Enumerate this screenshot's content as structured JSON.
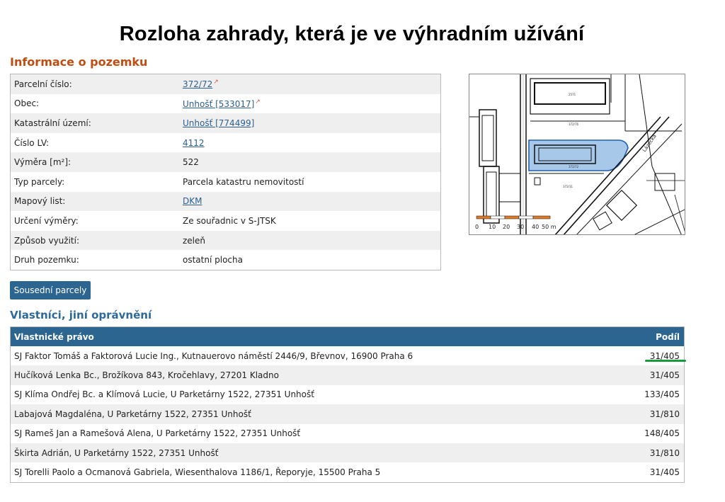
{
  "headline": "Rozloha zahrady, která je ve výhradním užívání",
  "info": {
    "title": "Informace o pozemku",
    "rows": [
      {
        "label": "Parcelní číslo:",
        "value": "372/72",
        "link": true,
        "ext": true
      },
      {
        "label": "Obec:",
        "value": "Unhošť [533017]",
        "link": true,
        "ext": true
      },
      {
        "label": "Katastrální území:",
        "value": "Unhošť [774499]",
        "link": true,
        "ext": false
      },
      {
        "label": "Číslo LV:",
        "value": "4112",
        "link": true,
        "ext": false
      },
      {
        "label": "Výměra [m²]:",
        "value": "522",
        "link": false,
        "ext": false
      },
      {
        "label": "Typ parcely:",
        "value": "Parcela katastru nemovitostí",
        "link": false,
        "ext": false
      },
      {
        "label": "Mapový list:",
        "value": "DKM",
        "link": true,
        "ext": false
      },
      {
        "label": "Určení výměry:",
        "value": "Ze souřadnic v S-JTSK",
        "link": false,
        "ext": false
      },
      {
        "label": "Způsob využití:",
        "value": "zeleň",
        "link": false,
        "ext": false
      },
      {
        "label": "Druh pozemku:",
        "value": "ostatní plocha",
        "link": false,
        "ext": false
      }
    ]
  },
  "map": {
    "street_label": "Lázecká",
    "scale_labels": [
      "0",
      "10",
      "20",
      "30",
      "40",
      "50 m"
    ]
  },
  "neighbors_button": "Sousední parcely",
  "owners": {
    "title": "Vlastníci, jiní oprávnění",
    "col_owner": "Vlastnické právo",
    "col_share": "Podíl",
    "rows": [
      {
        "owner": "SJ Faktor Tomáš a Faktorová Lucie Ing., Kutnauerovo náměstí 2446/9, Břevnov, 16900 Praha 6",
        "share": "31/405"
      },
      {
        "owner": "Hučíková Lenka Bc., Brožíkova 843, Kročehlavy, 27201 Kladno",
        "share": "31/405"
      },
      {
        "owner": "SJ Klíma Ondřej Bc. a Klímová Lucie, U Parketárny 1522, 27351 Unhošť",
        "share": "133/405"
      },
      {
        "owner": "Labajová Magdaléna, U Parketárny 1522, 27351 Unhošť",
        "share": "31/810"
      },
      {
        "owner": "SJ Rameš Jan a Ramešová Alena, U Parketárny 1522, 27351 Unhošť",
        "share": "148/405"
      },
      {
        "owner": "Škirta Adrián, U Parketárny 1522, 27351 Unhošť",
        "share": "31/810"
      },
      {
        "owner": "SJ Torelli Paolo a Ocmanová Gabriela, Wiesenthalova 1186/1, Řeporyje, 15500 Praha 5",
        "share": "31/405"
      }
    ]
  },
  "colors": {
    "accent_blue": "#2c6590",
    "section_orange": "#c04d12",
    "link_blue": "#2b5e8f",
    "highlight_green": "#1a9a3a",
    "parcel_fill": "#a8c8ea"
  }
}
